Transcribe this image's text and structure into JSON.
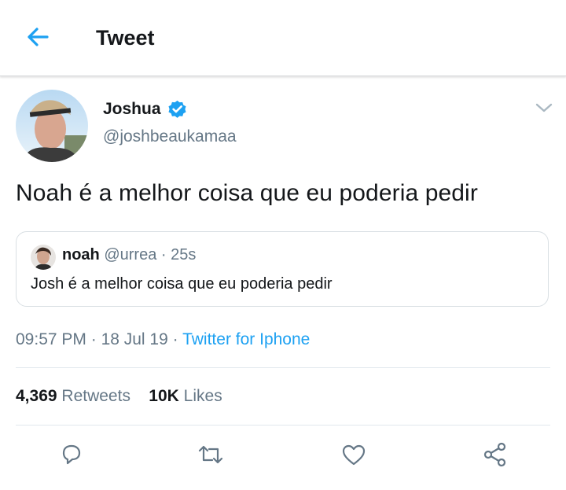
{
  "header": {
    "title": "Tweet",
    "back_icon": "arrow-left-icon",
    "accent": "#1da1f2"
  },
  "tweet": {
    "author": {
      "name": "Joshua",
      "handle": "@joshbeaukamaa",
      "verified": true
    },
    "text": "Noah é a melhor coisa que eu poderia pedir",
    "quote": {
      "name": "noah",
      "handle": "@urrea",
      "separator": " · ",
      "time": "25s",
      "text": "Josh é a melhor coisa que eu poderia pedir"
    },
    "time": "09:57 PM",
    "sep1": " · ",
    "date": "18 Jul 19",
    "sep2": " · ",
    "source": "Twitter for Iphone",
    "stats": {
      "retweets_count": "4,369",
      "retweets_label": "Retweets",
      "likes_count": "10K",
      "likes_label": "Likes"
    }
  },
  "actions": [
    {
      "icon": "reply-icon"
    },
    {
      "icon": "retweet-icon"
    },
    {
      "icon": "like-icon"
    },
    {
      "icon": "share-icon"
    }
  ]
}
